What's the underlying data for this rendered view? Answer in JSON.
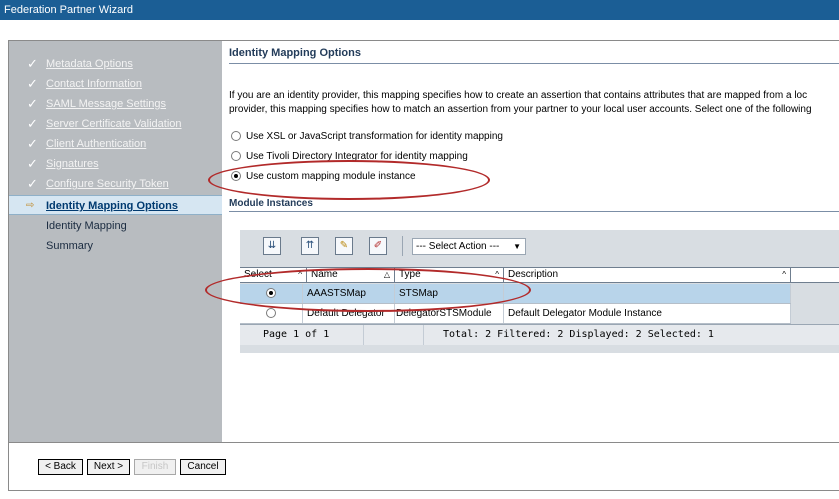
{
  "window": {
    "title": "Federation Partner Wizard"
  },
  "sidebar": {
    "items": [
      {
        "label": "Metadata Options",
        "state": "done"
      },
      {
        "label": "Contact Information",
        "state": "done"
      },
      {
        "label": "SAML Message Settings",
        "state": "done"
      },
      {
        "label": "Server Certificate Validation",
        "state": "done"
      },
      {
        "label": "Client Authentication",
        "state": "done"
      },
      {
        "label": "Signatures",
        "state": "done"
      },
      {
        "label": "Configure Security Token",
        "state": "done"
      },
      {
        "label": "Identity Mapping Options",
        "state": "current"
      },
      {
        "label": "Identity Mapping",
        "state": "future"
      },
      {
        "label": "Summary",
        "state": "future"
      }
    ]
  },
  "main": {
    "section_title": "Identity Mapping Options",
    "description_line1": "If you are an identity provider, this mapping specifies how to create an assertion that contains attributes that are mapped from a loc",
    "description_line2": "provider, this mapping specifies how to match an assertion from your partner to your local user accounts. Select one of the following",
    "options": [
      {
        "label": "Use XSL or JavaScript transformation for identity mapping",
        "selected": false
      },
      {
        "label": "Use Tivoli Directory Integrator for identity mapping",
        "selected": false
      },
      {
        "label": "Use custom mapping module instance",
        "selected": true
      }
    ],
    "modules_heading": "Module Instances",
    "toolbar": {
      "select_action": "--- Select Action ---"
    },
    "table": {
      "headers": [
        "Select",
        "Name",
        "Type",
        "Description"
      ],
      "rows": [
        {
          "selected": true,
          "name": "AAASTSMap",
          "type": "STSMap",
          "description": ""
        },
        {
          "selected": false,
          "name": "Default Delegator",
          "type": "DelegatorSTSModule",
          "description": "Default Delegator Module Instance"
        }
      ]
    },
    "pager": {
      "page": "Page 1 of 1",
      "stats": "Total: 2   Filtered: 2   Displayed: 2   Selected: 1"
    }
  },
  "footer": {
    "back": "< Back",
    "next": "Next >",
    "finish": "Finish",
    "cancel": "Cancel"
  },
  "colors": {
    "title_bar": "#1b5e95",
    "sidebar_bg": "#b8bcc0",
    "annotation": "#b22a2a",
    "selected_row": "#b8d4ea"
  }
}
